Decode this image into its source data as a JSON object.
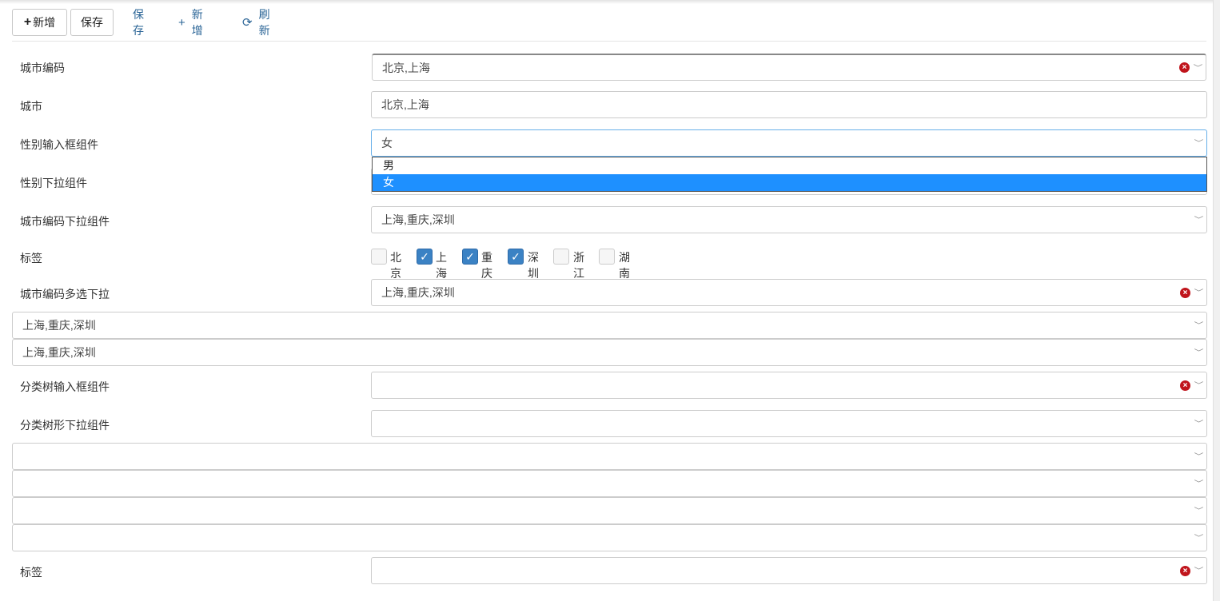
{
  "toolbar": {
    "btn_add": "新增",
    "btn_save": "保存",
    "link_save": "保存",
    "link_add": "新增",
    "link_refresh": "刷新"
  },
  "form": {
    "city_code_label": "城市编码",
    "city_code_value": "北京,上海",
    "city_label": "城市",
    "city_value": "北京,上海",
    "gender_input_label": "性别输入框组件",
    "gender_input_value": "女",
    "gender_options": [
      "男",
      "女"
    ],
    "gender_select_label": "性别下拉组件",
    "city_code_select_label": "城市编码下拉组件",
    "city_code_select_value": "上海,重庆,深圳",
    "tags_label": "标签",
    "tags": [
      {
        "label": "北京",
        "checked": false
      },
      {
        "label": "上海",
        "checked": true
      },
      {
        "label": "重庆",
        "checked": true
      },
      {
        "label": "深圳",
        "checked": true
      },
      {
        "label": "浙江",
        "checked": false
      },
      {
        "label": "湖南",
        "checked": false
      }
    ],
    "city_multi_label": "城市编码多选下拉",
    "city_multi_value": "上海,重庆,深圳",
    "wide_select_1_value": "上海,重庆,深圳",
    "wide_select_2_value": "上海,重庆,深圳",
    "tree_input_label": "分类树输入框组件",
    "tree_select_label": "分类树形下拉组件",
    "tags2_label": "标签"
  },
  "icons": {
    "clear": "clear-icon",
    "chevron": "chevron-down-icon",
    "plus": "plus-icon",
    "refresh": "refresh-icon"
  },
  "colors": {
    "link": "#2a6496",
    "selected_option": "#1e90ff",
    "checkbox_on": "#3b82c4",
    "clear_icon": "#c0151c"
  }
}
